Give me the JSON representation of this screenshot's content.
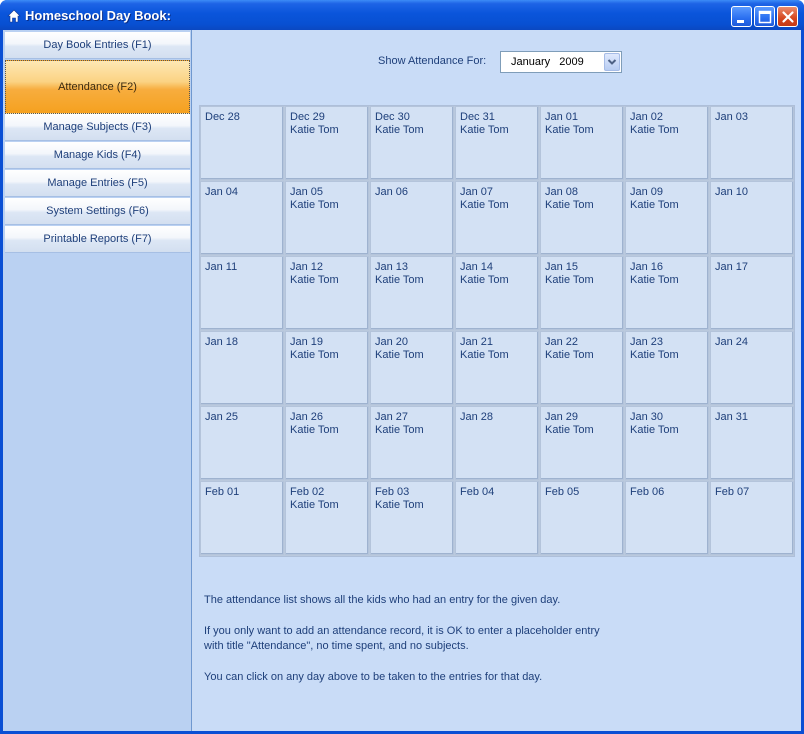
{
  "window": {
    "title": "Homeschool Day Book:"
  },
  "sidebar": {
    "items": [
      {
        "label": "Day Book Entries  (F1)",
        "active": false
      },
      {
        "label": "Attendance  (F2)",
        "active": true
      },
      {
        "label": "Manage Subjects  (F3)",
        "active": false
      },
      {
        "label": "Manage Kids  (F4)",
        "active": false
      },
      {
        "label": "Manage Entries  (F5)",
        "active": false
      },
      {
        "label": "System Settings  (F6)",
        "active": false
      },
      {
        "label": "Printable Reports  (F7)",
        "active": false
      }
    ]
  },
  "attendance": {
    "show_label": "Show Attendance For:",
    "month_value": "January   2009"
  },
  "calendar": {
    "weeks": [
      [
        {
          "date": "Dec 28",
          "kids": ""
        },
        {
          "date": "Dec 29",
          "kids": "Katie Tom"
        },
        {
          "date": "Dec 30",
          "kids": "Katie Tom"
        },
        {
          "date": "Dec 31",
          "kids": "Katie Tom"
        },
        {
          "date": "Jan 01",
          "kids": "Katie Tom"
        },
        {
          "date": "Jan 02",
          "kids": "Katie Tom"
        },
        {
          "date": "Jan 03",
          "kids": ""
        }
      ],
      [
        {
          "date": "Jan 04",
          "kids": ""
        },
        {
          "date": "Jan 05",
          "kids": "Katie Tom"
        },
        {
          "date": "Jan 06",
          "kids": ""
        },
        {
          "date": "Jan 07",
          "kids": "Katie Tom"
        },
        {
          "date": "Jan 08",
          "kids": "Katie Tom"
        },
        {
          "date": "Jan 09",
          "kids": "Katie Tom"
        },
        {
          "date": "Jan 10",
          "kids": ""
        }
      ],
      [
        {
          "date": "Jan 11",
          "kids": ""
        },
        {
          "date": "Jan 12",
          "kids": "Katie Tom"
        },
        {
          "date": "Jan 13",
          "kids": "Katie Tom"
        },
        {
          "date": "Jan 14",
          "kids": "Katie Tom"
        },
        {
          "date": "Jan 15",
          "kids": "Katie Tom"
        },
        {
          "date": "Jan 16",
          "kids": "Katie Tom"
        },
        {
          "date": "Jan 17",
          "kids": ""
        }
      ],
      [
        {
          "date": "Jan 18",
          "kids": ""
        },
        {
          "date": "Jan 19",
          "kids": "Katie Tom"
        },
        {
          "date": "Jan 20",
          "kids": "Katie Tom"
        },
        {
          "date": "Jan 21",
          "kids": "Katie Tom"
        },
        {
          "date": "Jan 22",
          "kids": "Katie Tom"
        },
        {
          "date": "Jan 23",
          "kids": "Katie Tom"
        },
        {
          "date": "Jan 24",
          "kids": ""
        }
      ],
      [
        {
          "date": "Jan 25",
          "kids": ""
        },
        {
          "date": "Jan 26",
          "kids": "Katie Tom"
        },
        {
          "date": "Jan 27",
          "kids": "Katie Tom"
        },
        {
          "date": "Jan 28",
          "kids": ""
        },
        {
          "date": "Jan 29",
          "kids": "Katie Tom"
        },
        {
          "date": "Jan 30",
          "kids": "Katie Tom"
        },
        {
          "date": "Jan 31",
          "kids": ""
        }
      ],
      [
        {
          "date": "Feb 01",
          "kids": ""
        },
        {
          "date": "Feb 02",
          "kids": "Katie Tom"
        },
        {
          "date": "Feb 03",
          "kids": "Katie Tom"
        },
        {
          "date": "Feb 04",
          "kids": ""
        },
        {
          "date": "Feb 05",
          "kids": ""
        },
        {
          "date": "Feb 06",
          "kids": ""
        },
        {
          "date": "Feb 07",
          "kids": ""
        }
      ]
    ]
  },
  "help": {
    "line1": "The attendance list shows all the kids who had an entry for the given day.",
    "line2a": "If you only want to add an attendance record, it is OK to enter a placeholder entry",
    "line2b": "with title \"Attendance\", no time spent, and no subjects.",
    "line3": "You can click on any day above to be taken to the entries for that day."
  },
  "colors": {
    "titlebar": "#0a55db",
    "sidebar_bg": "#bad1f2",
    "content_bg": "#c9dcf7",
    "active_nav": "#f7ad3e",
    "text": "#1e3f7a"
  },
  "icons": {
    "app": "home-icon",
    "minimize": "minimize-icon",
    "maximize": "maximize-icon",
    "close": "close-icon",
    "dropdown": "chevron-down-icon"
  }
}
